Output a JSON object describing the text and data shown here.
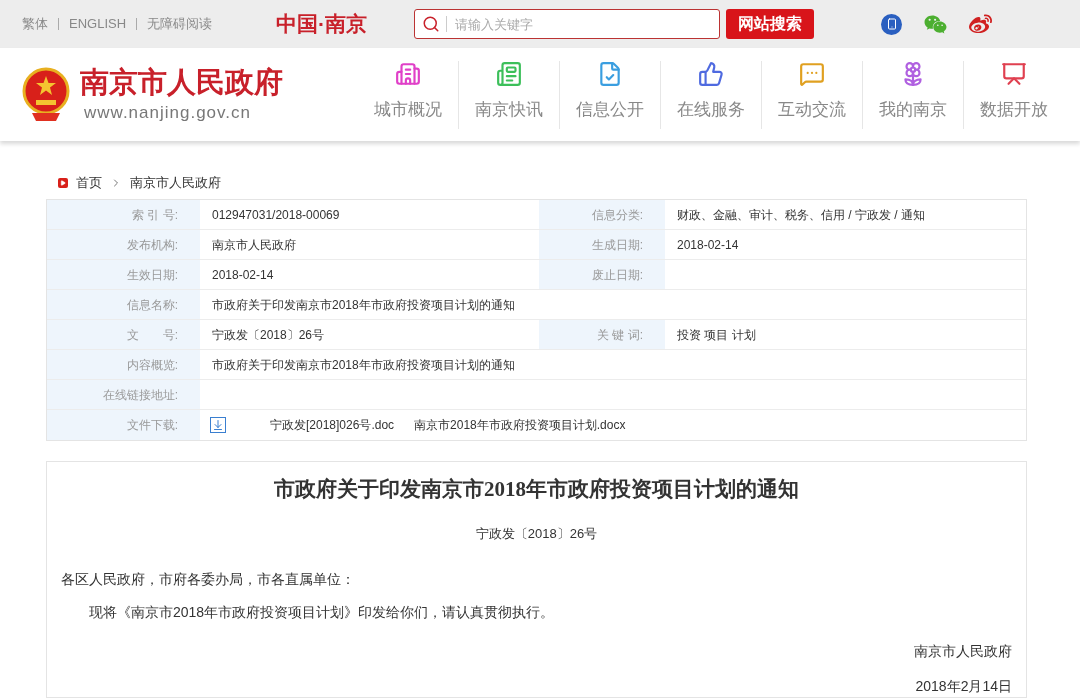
{
  "top_bar": {
    "links": [
      "繁体",
      "ENGLISH",
      "无障碍阅读"
    ],
    "brand": "中国·南京",
    "search": {
      "placeholder": "请输入关键字"
    },
    "search_button": "网站搜索"
  },
  "header": {
    "site_title": "南京市人民政府",
    "site_url": "www.nanjing.gov.cn",
    "nav": [
      {
        "label": "城市概况"
      },
      {
        "label": "南京快讯"
      },
      {
        "label": "信息公开"
      },
      {
        "label": "在线服务"
      },
      {
        "label": "互动交流"
      },
      {
        "label": "我的南京"
      },
      {
        "label": "数据开放"
      }
    ]
  },
  "breadcrumb": [
    "首页",
    "南京市人民政府"
  ],
  "meta_table": [
    {
      "kind": "pair",
      "cells": [
        {
          "label": "索 引 号:",
          "value": "012947031/2018-00069"
        },
        {
          "label": "信息分类:",
          "value": "财政、金融、审计、税务、信用 / 宁政发 / 通知"
        }
      ]
    },
    {
      "kind": "pair",
      "cells": [
        {
          "label": "发布机构:",
          "value": "南京市人民政府"
        },
        {
          "label": "生成日期:",
          "value": "2018-02-14"
        }
      ]
    },
    {
      "kind": "pair",
      "cells": [
        {
          "label": "生效日期:",
          "value": "2018-02-14"
        },
        {
          "label": "废止日期:"
        }
      ]
    },
    {
      "kind": "pair",
      "cells": [
        {
          "label": "信息名称:",
          "value": "市政府关于印发南京市2018年市政府投资项目计划的通知"
        }
      ]
    },
    {
      "kind": "pair",
      "cells": [
        {
          "label": "文　　号:",
          "value": "宁政发〔2018〕26号"
        },
        {
          "label": "关 键 词:",
          "value": "投资 项目 计划"
        }
      ]
    },
    {
      "kind": "pair",
      "cells": [
        {
          "label": "内容概览:",
          "value": "市政府关于印发南京市2018年市政府投资项目计划的通知"
        }
      ]
    },
    {
      "kind": "pair",
      "cells": [
        {
          "label": "在线链接地址:"
        }
      ]
    },
    {
      "kind": "files",
      "label": "文件下载:",
      "files": [
        "宁政发[2018]026号.doc",
        "南京市2018年市政府投资项目计划.docx"
      ]
    }
  ],
  "article": {
    "title": "市政府关于印发南京市2018年市政府投资项目计划的通知",
    "doc_number": "宁政发〔2018〕26号",
    "salutation": "各区人民政府，市府各委办局，市各直属单位：",
    "body": "现将《南京市2018年市政府投资项目计划》印发给你们，请认真贯彻执行。",
    "signature": "南京市人民政府",
    "date": "2018年2月14日"
  }
}
